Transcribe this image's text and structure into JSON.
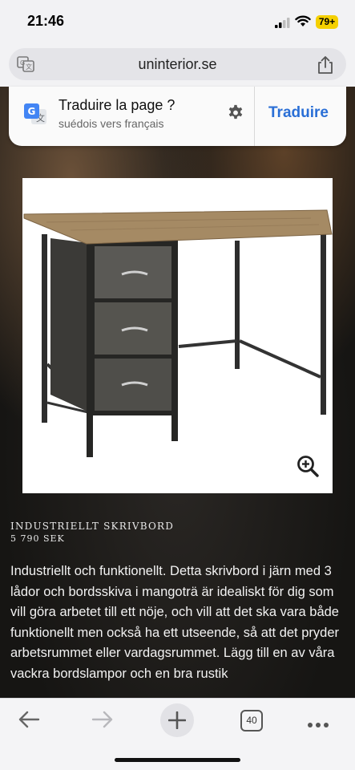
{
  "status_bar": {
    "time": "21:46",
    "battery": "79+",
    "battery_color": "#f5d000"
  },
  "browser": {
    "url": "uninterior.se",
    "tab_count": "40"
  },
  "translate_banner": {
    "title": "Traduire la page ?",
    "subtitle": "suédois vers français",
    "action_label": "Traduire",
    "action_color": "#2a6fd6"
  },
  "product": {
    "name": "INDUSTRIELLT SKRIVBORD",
    "price": "5 790 SEK",
    "description": "Industriellt och funktionellt. Detta skrivbord i järn med 3 lådor och bordsskiva i mangoträ är idealiskt för dig som vill göra arbetet till ett nöje, och vill att det ska vara både funktionellt men också ha ett utseende, så att det pryder arbetsrummet eller vardagsrummet. Lägg till en av våra vackra bordslampor och en bra rustik"
  },
  "icons": {
    "translate": "translate-icon",
    "share": "share-icon",
    "settings": "gear-icon",
    "zoom": "zoom-in-icon",
    "back": "back-arrow-icon",
    "forward": "forward-arrow-icon",
    "new_tab": "plus-icon",
    "more": "more-dots-icon"
  }
}
